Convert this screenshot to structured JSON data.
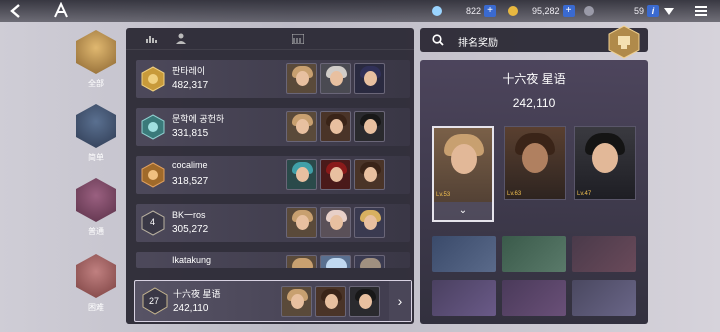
{
  "topbar": {
    "resource1_value": "822",
    "resource2_value": "95,282",
    "resource3_value": "59",
    "plus_label": "+",
    "info_label": "i"
  },
  "categories": [
    {
      "label": "全部",
      "active": true
    },
    {
      "label": "简单",
      "active": false
    },
    {
      "label": "普通",
      "active": false
    },
    {
      "label": "困难",
      "active": false
    }
  ],
  "rankings": [
    {
      "name": "판타레이",
      "score": "482,317",
      "rank": ""
    },
    {
      "name": "문학에 공헌하",
      "score": "331,815",
      "rank": ""
    },
    {
      "name": "cocalime",
      "score": "318,527",
      "rank": ""
    },
    {
      "name": "BK一ros",
      "score": "305,272",
      "rank": "4"
    },
    {
      "name": "Ikatakung",
      "score": "",
      "rank": ""
    }
  ],
  "my_rank": {
    "rank": "27",
    "name": "十六夜 星语",
    "score": "242,110"
  },
  "search": {
    "label": "排名奖励"
  },
  "detail": {
    "title": "十六夜 星语",
    "total": "242,110",
    "heroes": [
      {
        "level": "Lv.53"
      },
      {
        "level": "Lv.63"
      },
      {
        "level": "Lv.47"
      }
    ]
  },
  "colors": {
    "accent": "#3a6ad0",
    "gold": "#f2c050",
    "panel": "#26242f"
  }
}
